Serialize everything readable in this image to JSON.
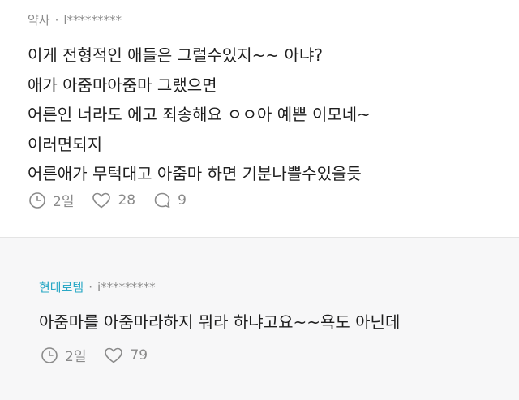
{
  "main_comment": {
    "author": "약사",
    "handle": "l*********",
    "separator": "·",
    "lines": [
      "이게 전형적인 애들은 그럴수있지~~ 아냐?",
      "애가 아줌마아줌마 그랬으면",
      "어른인 너라도 에고 죄송해요 ㅇㅇ아 예쁜 이모네~",
      "이러면되지",
      "어른애가 무턱대고 아줌마 하면 기분나쁠수있을듯"
    ],
    "time": "2일",
    "likes": "28",
    "replies": "9"
  },
  "reply": {
    "author": "현대로템",
    "handle": "i*********",
    "separator": "·",
    "text": "아줌마를 아줌마라하지 뭐라 하냐고요~~욕도 아닌데",
    "time": "2일",
    "likes": "79"
  },
  "colors": {
    "reply_author": "#2aa8c5",
    "meta_gray": "#8a8a8a",
    "reply_background": "#f7f7f8"
  }
}
